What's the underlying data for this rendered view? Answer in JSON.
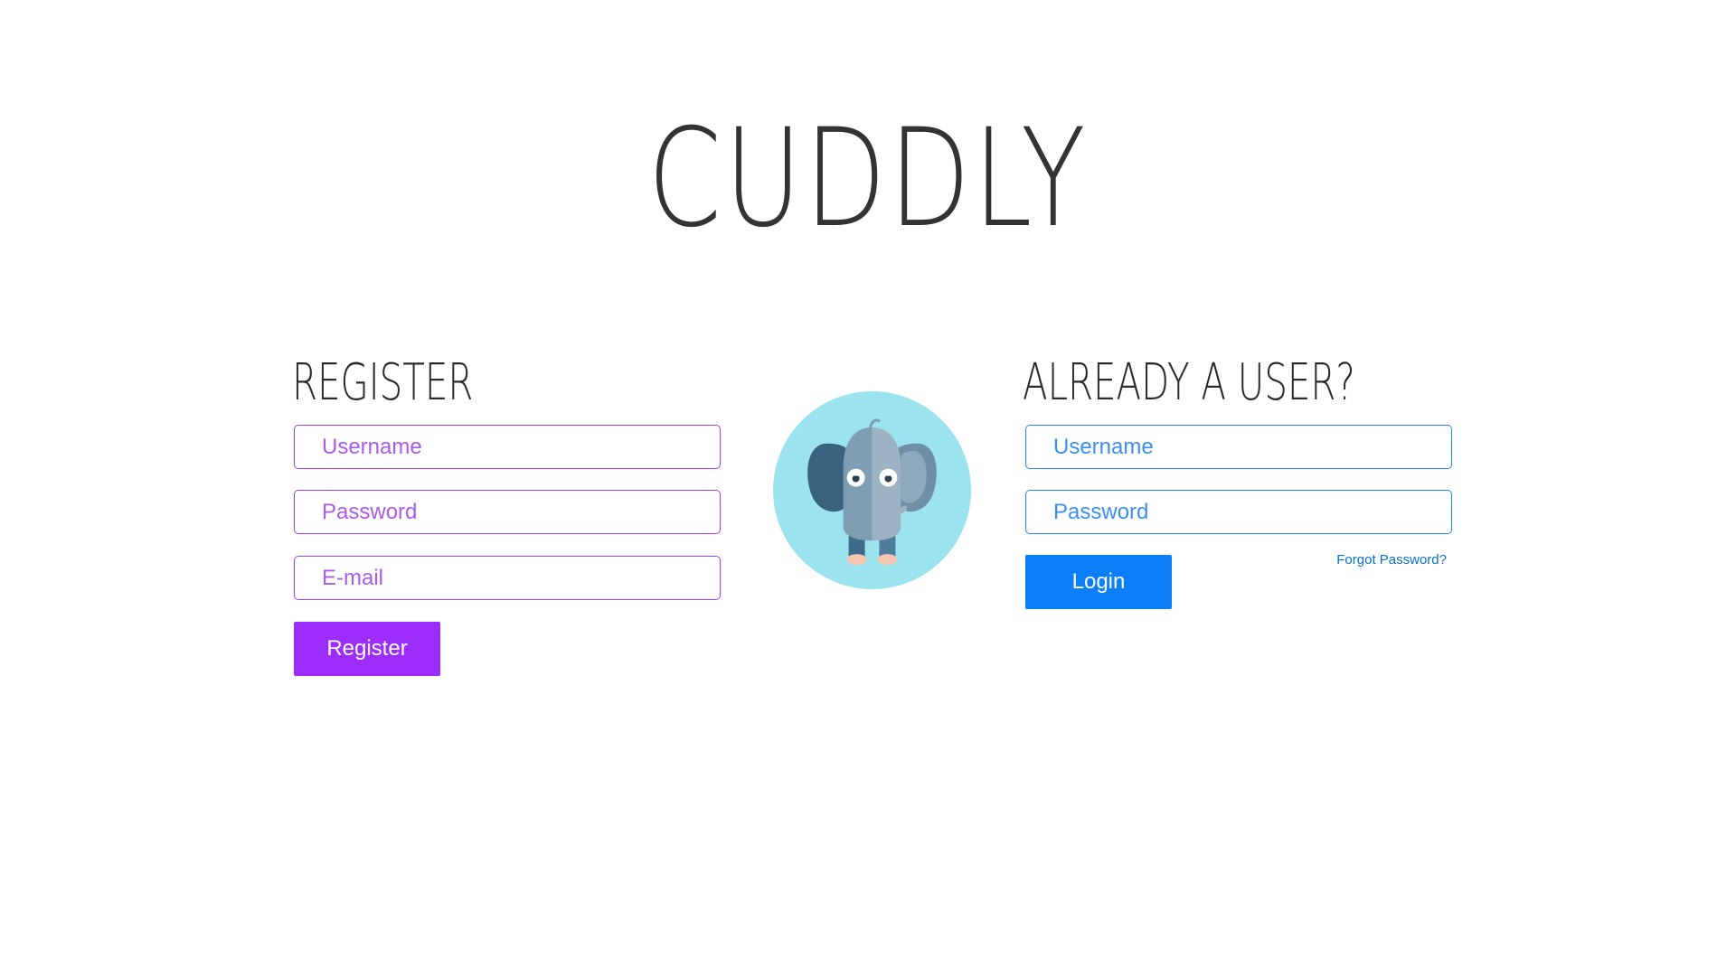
{
  "app": {
    "logo_text": "CUDDLY"
  },
  "register": {
    "title": "REGISTER",
    "username_placeholder": "Username",
    "password_placeholder": "Password",
    "email_placeholder": "E-mail",
    "submit_label": "Register",
    "accent_color": "#9b2cfa"
  },
  "login": {
    "title": "ALREADY A USER?",
    "username_placeholder": "Username",
    "password_placeholder": "Password",
    "submit_label": "Login",
    "forgot_link": "Forgot Password?",
    "accent_color": "#0a7ff7"
  },
  "mascot": {
    "icon": "elephant-icon",
    "background_color": "#9be3ef"
  }
}
